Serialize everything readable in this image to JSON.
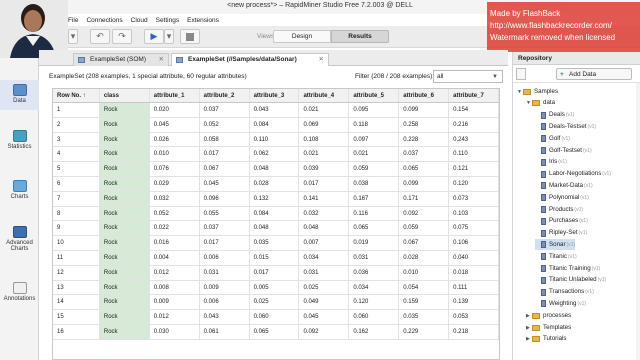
{
  "window": {
    "title": "<new process*> – RapidMiner Studio Free 7.2.003 @ DELL"
  },
  "menu": [
    "File",
    "Connections",
    "Cloud",
    "Settings",
    "Extensions"
  ],
  "toolbar": {
    "views_label": "Views:",
    "design": "Design",
    "results": "Results"
  },
  "watermark": [
    "Made by FlashBack",
    "http://www.flashbackrecorder.com/",
    "Watermark removed when licensed"
  ],
  "left_panel": [
    {
      "label": "Data",
      "icon": "data-grid-icon",
      "active": true
    },
    {
      "label": "Statistics",
      "icon": "statistics-icon"
    },
    {
      "label": "Charts",
      "icon": "charts-icon"
    },
    {
      "label": "Advanced Charts",
      "icon": "advanced-charts-icon"
    },
    {
      "label": "Annotations",
      "icon": "annotations-icon"
    }
  ],
  "tabs": [
    {
      "label": "ExampleSet (SOM)"
    },
    {
      "label": "ExampleSet (//Samples/data/Sonar)",
      "active": true
    }
  ],
  "summary": "ExampleSet (208 examples, 1 special attribute, 60 regular attributes)",
  "filter": {
    "label": "Filter (208 / 208 examples):",
    "value": "all"
  },
  "table": {
    "headers": [
      "Row No. ↑",
      "class",
      "attribute_1",
      "attribute_2",
      "attribute_3",
      "attribute_4",
      "attribute_5",
      "attribute_6",
      "attribute_7"
    ],
    "rows": [
      [
        "1",
        "Rock",
        "0.020",
        "0.037",
        "0.043",
        "0.021",
        "0.095",
        "0.099",
        "0.154"
      ],
      [
        "2",
        "Rock",
        "0.045",
        "0.052",
        "0.084",
        "0.069",
        "0.118",
        "0.258",
        "0.216"
      ],
      [
        "3",
        "Rock",
        "0.026",
        "0.058",
        "0.110",
        "0.108",
        "0.097",
        "0.228",
        "0.243"
      ],
      [
        "4",
        "Rock",
        "0.010",
        "0.017",
        "0.062",
        "0.021",
        "0.021",
        "0.037",
        "0.110"
      ],
      [
        "5",
        "Rock",
        "0.076",
        "0.067",
        "0.048",
        "0.039",
        "0.059",
        "0.065",
        "0.121"
      ],
      [
        "6",
        "Rock",
        "0.029",
        "0.045",
        "0.028",
        "0.017",
        "0.038",
        "0.099",
        "0.120"
      ],
      [
        "7",
        "Rock",
        "0.032",
        "0.096",
        "0.132",
        "0.141",
        "0.167",
        "0.171",
        "0.073"
      ],
      [
        "8",
        "Rock",
        "0.052",
        "0.055",
        "0.084",
        "0.032",
        "0.116",
        "0.092",
        "0.103"
      ],
      [
        "9",
        "Rock",
        "0.022",
        "0.037",
        "0.048",
        "0.048",
        "0.065",
        "0.059",
        "0.075"
      ],
      [
        "10",
        "Rock",
        "0.016",
        "0.017",
        "0.035",
        "0.007",
        "0.019",
        "0.067",
        "0.106"
      ],
      [
        "11",
        "Rock",
        "0.004",
        "0.006",
        "0.015",
        "0.034",
        "0.031",
        "0.028",
        "0.040"
      ],
      [
        "12",
        "Rock",
        "0.012",
        "0.031",
        "0.017",
        "0.031",
        "0.036",
        "0.010",
        "0.018"
      ],
      [
        "13",
        "Rock",
        "0.008",
        "0.009",
        "0.005",
        "0.025",
        "0.034",
        "0.054",
        "0.111"
      ],
      [
        "14",
        "Rock",
        "0.009",
        "0.006",
        "0.025",
        "0.049",
        "0.120",
        "0.159",
        "0.139"
      ],
      [
        "15",
        "Rock",
        "0.012",
        "0.043",
        "0.060",
        "0.045",
        "0.060",
        "0.035",
        "0.053"
      ],
      [
        "16",
        "Rock",
        "0.030",
        "0.061",
        "0.065",
        "0.092",
        "0.162",
        "0.229",
        "0.218"
      ]
    ]
  },
  "repository": {
    "title": "Repository",
    "add_data": "Add Data",
    "tree": [
      {
        "label": "Samples",
        "level": 0,
        "type": "folder",
        "expanded": true
      },
      {
        "label": "data",
        "level": 1,
        "type": "folder",
        "expanded": true
      },
      {
        "label": "Deals",
        "level": 2,
        "type": "db",
        "ver": "(v1)"
      },
      {
        "label": "Deals-Testset",
        "level": 2,
        "type": "db",
        "ver": "(v1)"
      },
      {
        "label": "Golf",
        "level": 2,
        "type": "db",
        "ver": "(v1)"
      },
      {
        "label": "Golf-Testset",
        "level": 2,
        "type": "db",
        "ver": "(v1)"
      },
      {
        "label": "Iris",
        "level": 2,
        "type": "db",
        "ver": "(v1)"
      },
      {
        "label": "Labor-Negotiations",
        "level": 2,
        "type": "db",
        "ver": "(v1)"
      },
      {
        "label": "Market-Data",
        "level": 2,
        "type": "db",
        "ver": "(v1)"
      },
      {
        "label": "Polynomial",
        "level": 2,
        "type": "db",
        "ver": "(v1)"
      },
      {
        "label": "Products",
        "level": 2,
        "type": "db",
        "ver": "(v1)"
      },
      {
        "label": "Purchases",
        "level": 2,
        "type": "db",
        "ver": "(v1)"
      },
      {
        "label": "Ripley-Set",
        "level": 2,
        "type": "db",
        "ver": "(v1)"
      },
      {
        "label": "Sonar",
        "level": 2,
        "type": "db",
        "ver": "(v1)",
        "selected": true
      },
      {
        "label": "Titanic",
        "level": 2,
        "type": "db",
        "ver": "(v1)"
      },
      {
        "label": "Titanic Training",
        "level": 2,
        "type": "db",
        "ver": "(v1)"
      },
      {
        "label": "Titanic Unlabeled",
        "level": 2,
        "type": "db",
        "ver": "(v1)"
      },
      {
        "label": "Transactions",
        "level": 2,
        "type": "db",
        "ver": "(v1)"
      },
      {
        "label": "Weighting",
        "level": 2,
        "type": "db",
        "ver": "(v1)"
      },
      {
        "label": "processes",
        "level": 1,
        "type": "folder",
        "expanded": false
      },
      {
        "label": "Templates",
        "level": 1,
        "type": "folder",
        "expanded": false
      },
      {
        "label": "Tutorials",
        "level": 1,
        "type": "folder",
        "expanded": false
      }
    ]
  }
}
